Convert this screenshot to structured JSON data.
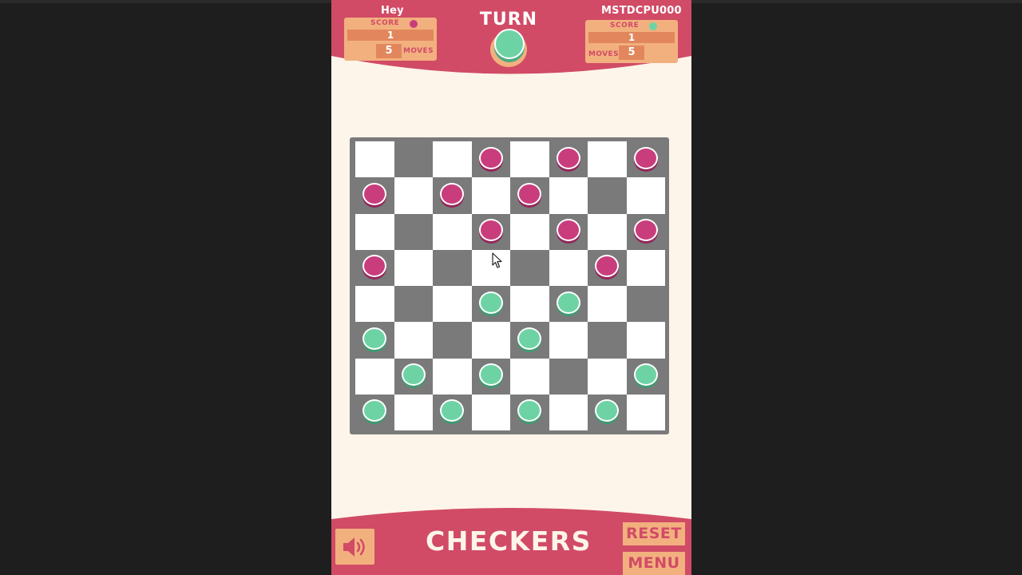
{
  "colors": {
    "header_pink": "#d14b66",
    "panel_peach": "#f2b07f",
    "panel_accent": "#e2875d",
    "pink_piece": "#c93d7d",
    "green_piece": "#6ed3a4",
    "dark_square": "#7a7a7a",
    "light_square": "#ffffff",
    "background_cream": "#fdf5e9"
  },
  "header": {
    "turn_label": "TURN",
    "turn_piece": "green",
    "player_left": {
      "name": "Hey",
      "score_label": "SCORE",
      "score": "1",
      "moves": "5",
      "moves_label": "MOVES",
      "piece_color": "pink"
    },
    "player_right": {
      "name": "MSTDCPU000",
      "score_label": "SCORE",
      "score": "1",
      "moves": "5",
      "moves_label": "MOVES",
      "piece_color": "green"
    }
  },
  "board": {
    "size": 8,
    "dark_squares_where": "row+col is odd",
    "pieces": [
      {
        "row": 0,
        "col": 3,
        "color": "pink"
      },
      {
        "row": 0,
        "col": 5,
        "color": "pink"
      },
      {
        "row": 0,
        "col": 7,
        "color": "pink"
      },
      {
        "row": 1,
        "col": 0,
        "color": "pink"
      },
      {
        "row": 1,
        "col": 2,
        "color": "pink"
      },
      {
        "row": 1,
        "col": 4,
        "color": "pink"
      },
      {
        "row": 2,
        "col": 3,
        "color": "pink"
      },
      {
        "row": 2,
        "col": 5,
        "color": "pink"
      },
      {
        "row": 2,
        "col": 7,
        "color": "pink"
      },
      {
        "row": 3,
        "col": 0,
        "color": "pink"
      },
      {
        "row": 3,
        "col": 6,
        "color": "pink"
      },
      {
        "row": 4,
        "col": 3,
        "color": "green"
      },
      {
        "row": 4,
        "col": 5,
        "color": "green"
      },
      {
        "row": 5,
        "col": 0,
        "color": "green"
      },
      {
        "row": 5,
        "col": 4,
        "color": "green"
      },
      {
        "row": 6,
        "col": 1,
        "color": "green"
      },
      {
        "row": 6,
        "col": 3,
        "color": "green"
      },
      {
        "row": 6,
        "col": 7,
        "color": "green"
      },
      {
        "row": 7,
        "col": 0,
        "color": "green"
      },
      {
        "row": 7,
        "col": 2,
        "color": "green"
      },
      {
        "row": 7,
        "col": 4,
        "color": "green"
      },
      {
        "row": 7,
        "col": 6,
        "color": "green"
      }
    ]
  },
  "footer": {
    "title": "CHECKERS",
    "reset_label": "RESET",
    "menu_label": "MENU",
    "sound_icon": "speaker-icon"
  }
}
